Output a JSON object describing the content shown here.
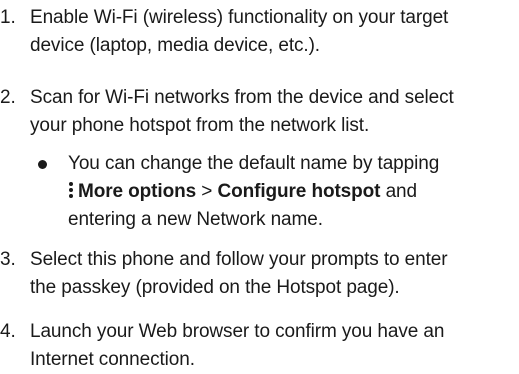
{
  "steps": [
    {
      "number": "1.",
      "lines": [
        "Enable Wi-Fi (wireless) functionality on your target",
        "device (laptop, media device, etc.)."
      ]
    },
    {
      "number": "2.",
      "lines": [
        "Scan for Wi-Fi networks from the device and select",
        "your phone hotspot from the network list."
      ]
    },
    {
      "number": "3.",
      "lines": [
        "Select this phone and follow your prompts to enter",
        "the passkey (provided on the Hotspot page)."
      ]
    },
    {
      "number": "4.",
      "lines": [
        "Launch your Web browser to confirm you have an",
        "Internet connection."
      ]
    }
  ],
  "note": {
    "line1": "You can change the default name by tapping",
    "more_options": "More options",
    "separator": ">",
    "configure_hotspot": "Configure hotspot",
    "and_text": "and",
    "line3": "entering a new Network name."
  },
  "icons": {
    "bullet": "bullet-dot-icon",
    "more_options": "more-options-vertical-dots-icon"
  }
}
